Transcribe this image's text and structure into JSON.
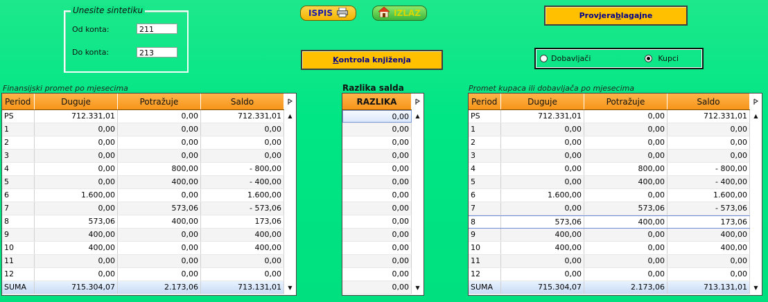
{
  "sintetika": {
    "legend": "Unesite sintetiku",
    "od_label": "Od konta:",
    "od_value": "211",
    "do_label": "Do konta:",
    "do_value": "213"
  },
  "buttons": {
    "ispis": "ISPIS",
    "izlaz": "IZLAZ",
    "provjera_pre": "Provjera ",
    "provjera_ul": "b",
    "provjera_post": "lagajne",
    "kontrola_ul": "K",
    "kontrola_post": "ontrola knjiženja"
  },
  "radio": {
    "dobavljaci": "Dobavljači",
    "kupci": "Kupci",
    "selected": "Kupci"
  },
  "captions": {
    "left": "Finansijski promet po mjesecima",
    "middle": "Razlika salda",
    "right": "Promet kupaca ili dobavljača po mjesecima"
  },
  "left_grid": {
    "headers": [
      "Period",
      "Duguje",
      "Potražuje",
      "Saldo"
    ],
    "rows": [
      [
        "PS",
        "712.331,01",
        "0,00",
        "712.331,01"
      ],
      [
        "1",
        "0,00",
        "0,00",
        "0,00"
      ],
      [
        "2",
        "0,00",
        "0,00",
        "0,00"
      ],
      [
        "3",
        "0,00",
        "0,00",
        "0,00"
      ],
      [
        "4",
        "0,00",
        "800,00",
        "- 800,00"
      ],
      [
        "5",
        "0,00",
        "400,00",
        "- 400,00"
      ],
      [
        "6",
        "1.600,00",
        "0,00",
        "1.600,00"
      ],
      [
        "7",
        "0,00",
        "573,06",
        "- 573,06"
      ],
      [
        "8",
        "573,06",
        "400,00",
        "173,06"
      ],
      [
        "9",
        "400,00",
        "0,00",
        "400,00"
      ],
      [
        "10",
        "400,00",
        "0,00",
        "400,00"
      ],
      [
        "11",
        "0,00",
        "0,00",
        "0,00"
      ],
      [
        "12",
        "0,00",
        "0,00",
        "0,00"
      ],
      [
        "SUMA",
        "715.304,07",
        "2.173,06",
        "713.131,01"
      ]
    ]
  },
  "middle_grid": {
    "header": "RAZLIKA",
    "rows": [
      "0,00",
      "0,00",
      "0,00",
      "0,00",
      "0,00",
      "0,00",
      "0,00",
      "0,00",
      "0,00",
      "0,00",
      "0,00",
      "0,00",
      "0,00",
      "0,00"
    ]
  },
  "right_grid": {
    "headers": [
      "Period",
      "Duguje",
      "Potražuje",
      "Saldo"
    ],
    "rows": [
      [
        "PS",
        "712.331,01",
        "0,00",
        "712.331,01"
      ],
      [
        "1",
        "0,00",
        "0,00",
        "0,00"
      ],
      [
        "2",
        "0,00",
        "0,00",
        "0,00"
      ],
      [
        "3",
        "0,00",
        "0,00",
        "0,00"
      ],
      [
        "4",
        "0,00",
        "800,00",
        "- 800,00"
      ],
      [
        "5",
        "0,00",
        "400,00",
        "- 400,00"
      ],
      [
        "6",
        "1.600,00",
        "0,00",
        "1.600,00"
      ],
      [
        "7",
        "0,00",
        "573,06",
        "- 573,06"
      ],
      [
        "8",
        "573,06",
        "400,00",
        "173,06"
      ],
      [
        "9",
        "400,00",
        "0,00",
        "400,00"
      ],
      [
        "10",
        "400,00",
        "0,00",
        "400,00"
      ],
      [
        "11",
        "0,00",
        "0,00",
        "0,00"
      ],
      [
        "12",
        "0,00",
        "0,00",
        "0,00"
      ],
      [
        "SUMA",
        "715.304,07",
        "2.173,06",
        "713.131,01"
      ]
    ]
  },
  "icons": {
    "printer": "printer-icon",
    "house": "house-icon",
    "column_selector": "column-selector-icon",
    "scroll_up": "scroll-up-icon",
    "scroll_down": "scroll-down-icon"
  }
}
